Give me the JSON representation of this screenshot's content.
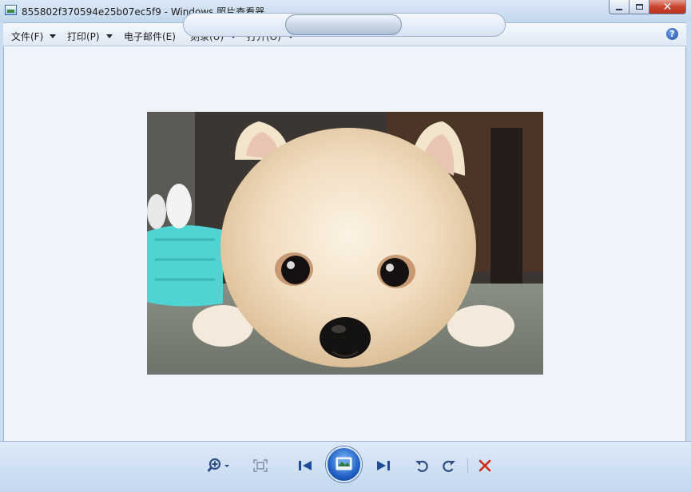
{
  "window": {
    "title": "855802f370594e25b07ec5f9 - Windows 照片查看器",
    "minimize_icon": "minimize-icon",
    "maximize_icon": "maximize-icon",
    "close_icon": "close-icon"
  },
  "menu": {
    "items": [
      {
        "label": "文件(F)",
        "has_dropdown": true
      },
      {
        "label": "打印(P)",
        "has_dropdown": true
      },
      {
        "label": "电子邮件(E)",
        "has_dropdown": false
      },
      {
        "label": "刻录(U)",
        "has_dropdown": true
      },
      {
        "label": "打开(O)",
        "has_dropdown": true
      }
    ],
    "help_label": "?"
  },
  "photo": {
    "subject": "pomeranian puppy lying on the floor"
  },
  "toolbar": {
    "icons": [
      "zoom-icon",
      "actual-size-icon",
      "previous-icon",
      "slideshow-icon",
      "next-icon",
      "rotate-left-icon",
      "rotate-right-icon",
      "delete-icon"
    ],
    "accent_color": "#2e4f86",
    "delete_color": "#cc2a1a"
  }
}
